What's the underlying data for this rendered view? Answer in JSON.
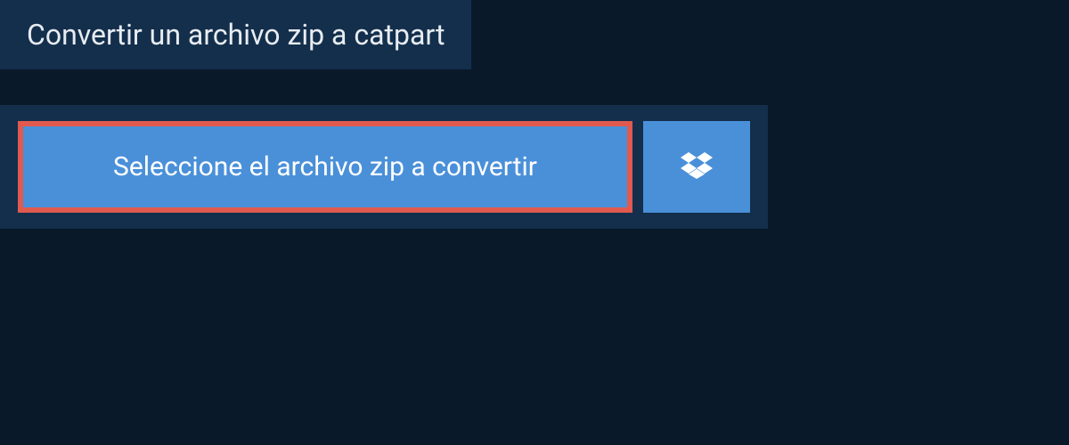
{
  "header": {
    "title": "Convertir un archivo zip a catpart"
  },
  "upload": {
    "select_file_label": "Seleccione el archivo zip a convertir"
  }
}
